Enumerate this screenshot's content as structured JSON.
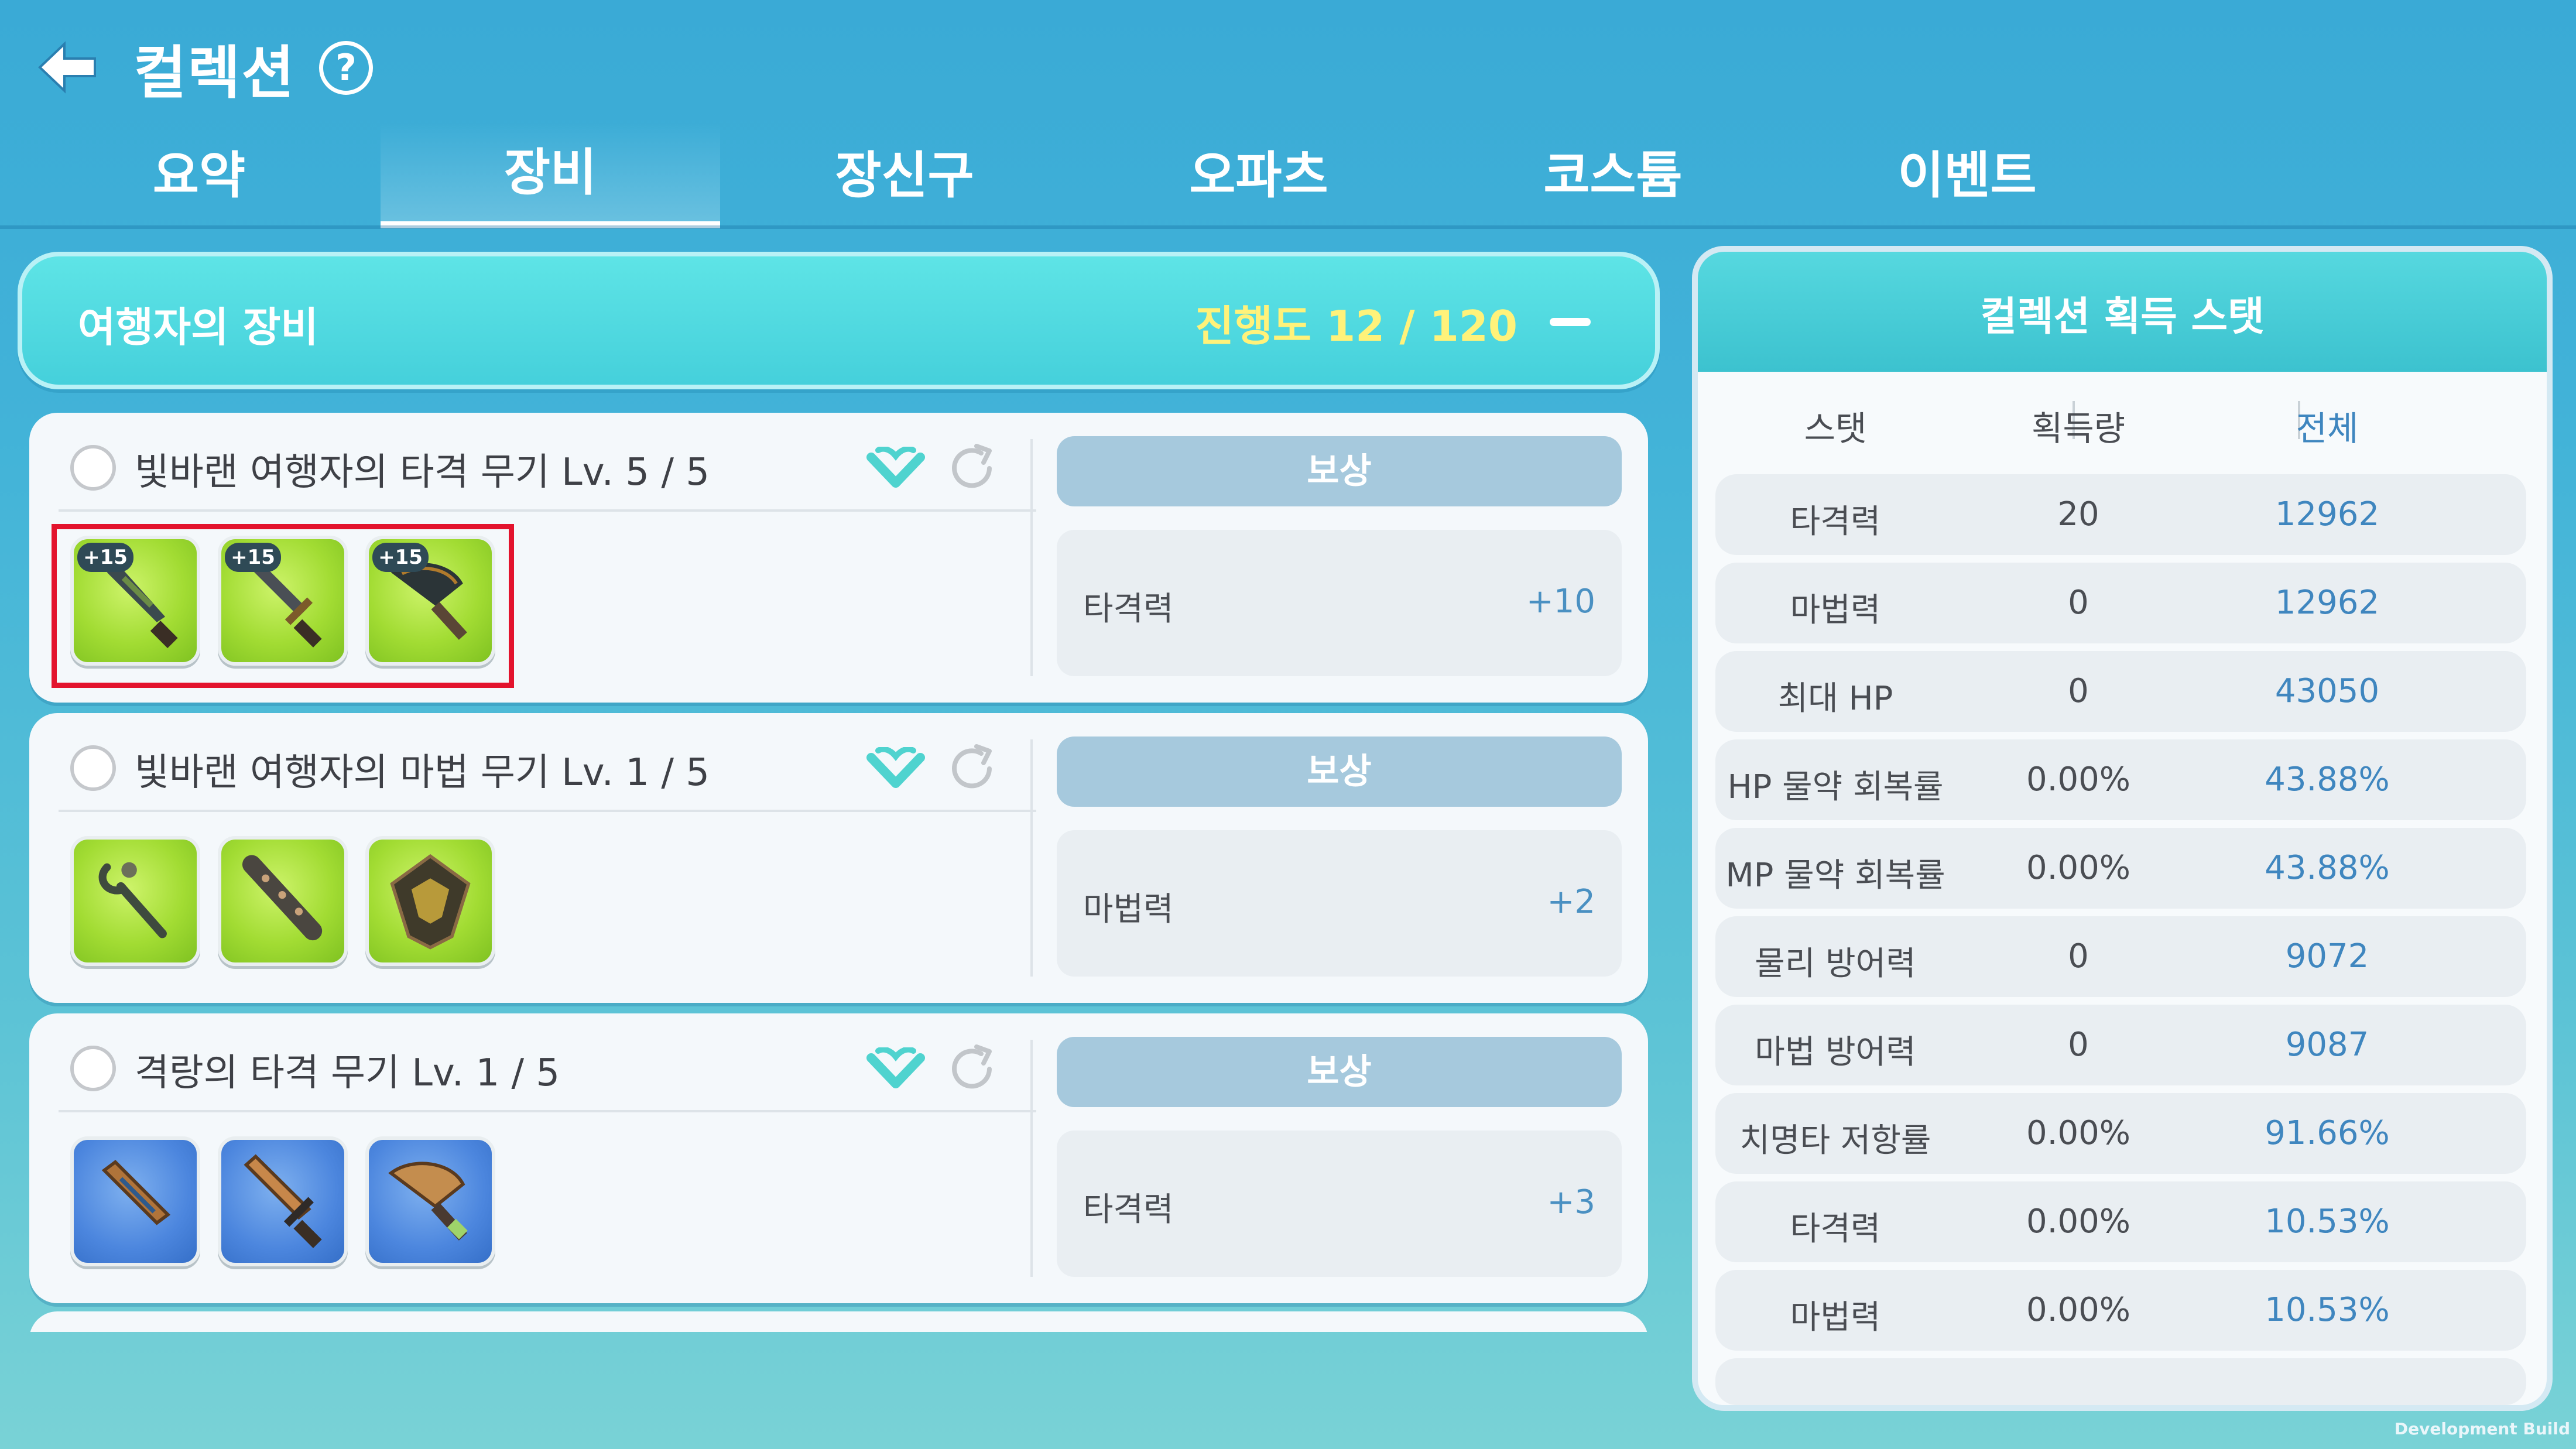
{
  "header": {
    "title": "컬렉션",
    "help_label": "?"
  },
  "tabs": [
    {
      "label": "요약",
      "active": false
    },
    {
      "label": "장비",
      "active": true
    },
    {
      "label": "장신구",
      "active": false
    },
    {
      "label": "오파츠",
      "active": false
    },
    {
      "label": "코스튬",
      "active": false
    },
    {
      "label": "이벤트",
      "active": false
    }
  ],
  "group": {
    "title": "여행자의 장비",
    "progress": "진행도 12 / 120"
  },
  "collections": [
    {
      "name": "빛바랜 여행자의 타격 무기 Lv. 5 / 5",
      "reward_label": "보상",
      "reward_stat": "타격력",
      "reward_value": "+10",
      "items": [
        {
          "icon": "club-weapon-icon",
          "badge": "+15"
        },
        {
          "icon": "sword-weapon-icon",
          "badge": "+15"
        },
        {
          "icon": "axe-weapon-icon",
          "badge": "+15"
        }
      ]
    },
    {
      "name": "빛바랜 여행자의 마법 무기 Lv. 1 / 5",
      "reward_label": "보상",
      "reward_stat": "마법력",
      "reward_value": "+2",
      "items": [
        {
          "icon": "staff-icon",
          "badge": ""
        },
        {
          "icon": "mace-icon",
          "badge": ""
        },
        {
          "icon": "shield-icon",
          "badge": ""
        }
      ]
    },
    {
      "name": "격랑의 타격 무기 Lv. 1 / 5",
      "reward_label": "보상",
      "reward_stat": "타격력",
      "reward_value": "+3",
      "items": [
        {
          "icon": "club-weapon-icon",
          "badge": ""
        },
        {
          "icon": "sword-weapon-icon",
          "badge": ""
        },
        {
          "icon": "axe-weapon-icon",
          "badge": ""
        }
      ]
    }
  ],
  "stats_panel": {
    "title": "컬렉션 획득 스탯",
    "columns": [
      "스탯",
      "획득량",
      "전체"
    ],
    "rows": [
      {
        "stat": "타격력",
        "gained": "20",
        "total": "12962"
      },
      {
        "stat": "마법력",
        "gained": "0",
        "total": "12962"
      },
      {
        "stat": "최대 HP",
        "gained": "0",
        "total": "43050"
      },
      {
        "stat": "HP 물약 회복률",
        "gained": "0.00%",
        "total": "43.88%"
      },
      {
        "stat": "MP 물약 회복률",
        "gained": "0.00%",
        "total": "43.88%"
      },
      {
        "stat": "물리 방어력",
        "gained": "0",
        "total": "9072"
      },
      {
        "stat": "마법 방어력",
        "gained": "0",
        "total": "9087"
      },
      {
        "stat": "치명타 저항률",
        "gained": "0.00%",
        "total": "91.66%"
      },
      {
        "stat": "타격력",
        "gained": "0.00%",
        "total": "10.53%"
      },
      {
        "stat": "마법력",
        "gained": "0.00%",
        "total": "10.53%"
      }
    ]
  },
  "colors": {
    "accent": "#45d0db",
    "progress_text": "#fff27a",
    "highlight": "#e3132d",
    "stat_total": "#3f86bf"
  },
  "footer": {
    "dev_build": "Development Build"
  }
}
